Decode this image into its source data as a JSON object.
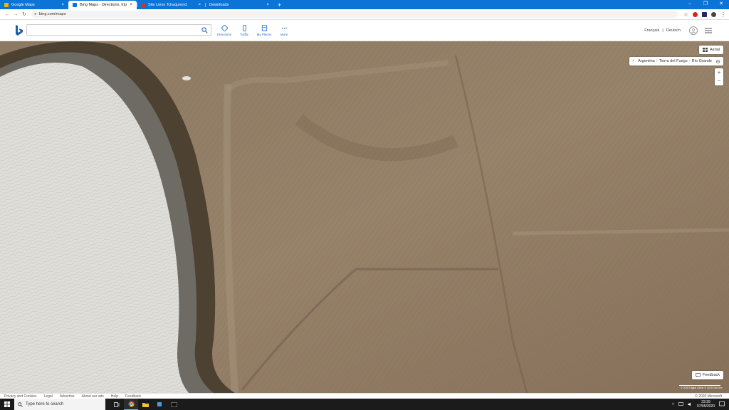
{
  "browser": {
    "tabs": [
      {
        "title": "Google Maps",
        "close": "×",
        "favicon_color": "#f5b400"
      },
      {
        "title": "Bing Maps - Directions, trip pla...",
        "close": "×",
        "favicon_color": "#0b74d6"
      },
      {
        "title": "Site Liens Tchaqurend",
        "close": "×",
        "favicon_color": "#c0392b"
      },
      {
        "title": "Downloads",
        "close": "×",
        "favicon_color": "#0b74d6"
      }
    ],
    "new_tab": "+",
    "window_controls": {
      "minimize": "–",
      "maximize": "❐",
      "close": "✕"
    },
    "nav": {
      "back": "←",
      "forward": "→",
      "reload": "↻"
    },
    "url": "bing.com/maps",
    "star": "☆",
    "menu": "⋮"
  },
  "header": {
    "search_placeholder": "",
    "tools": [
      {
        "label": "Directions",
        "icon": "directions-icon"
      },
      {
        "label": "Traffic",
        "icon": "traffic-icon"
      },
      {
        "label": "My Places",
        "icon": "my-places-icon"
      },
      {
        "label": "More",
        "icon": "more-icon"
      }
    ],
    "languages": [
      "Français",
      "|",
      "Deutsch"
    ],
    "accent_color": "#2a6fbf"
  },
  "map": {
    "style_label": "Aerial",
    "breadcrumb": {
      "close": "×",
      "parts": [
        "Argentina",
        "Tierra del Fuego",
        "Río Grande"
      ],
      "separator": "›"
    },
    "zoom_in": "+",
    "zoom_out": "−",
    "feedback_label": "Feedback",
    "scale_text": "© 2020 Digital Globe  © 2019 TomTom"
  },
  "footer": {
    "links": [
      "Privacy and Cookies",
      "Legal",
      "Advertise",
      "About our ads",
      "Help",
      "Feedback"
    ],
    "copyright": "© 2020 Microsoft"
  },
  "taskbar": {
    "search_placeholder": "Type here to search",
    "time": "23:39",
    "date": "07/05/2020",
    "tray_chevron": "˄"
  }
}
